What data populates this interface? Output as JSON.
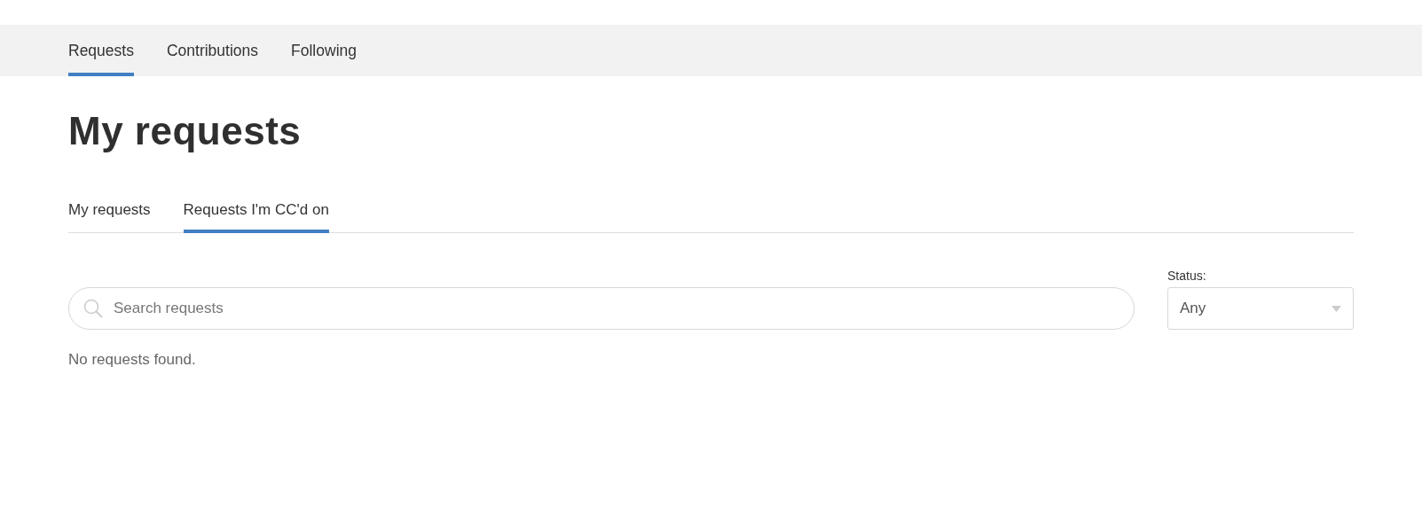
{
  "nav_tabs": [
    {
      "label": "Requests",
      "selected": true
    },
    {
      "label": "Contributions",
      "selected": false
    },
    {
      "label": "Following",
      "selected": false
    }
  ],
  "title": "My requests",
  "sub_tabs": [
    {
      "label": "My requests",
      "selected": false
    },
    {
      "label": "Requests I'm CC'd on",
      "selected": true
    }
  ],
  "search": {
    "placeholder": "Search requests"
  },
  "status_filter": {
    "label": "Status:",
    "value": "Any"
  },
  "empty_message": "No requests found."
}
